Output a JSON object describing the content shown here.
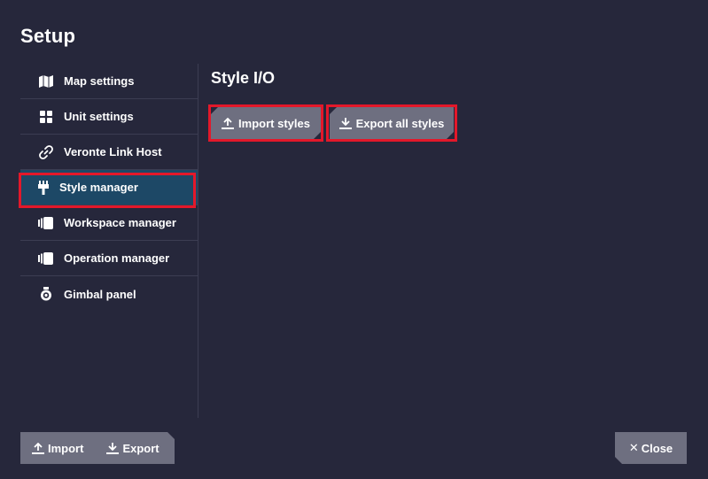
{
  "dialog": {
    "title": "Setup"
  },
  "sidebar": {
    "items": [
      {
        "label": "Map settings",
        "icon": "map-icon"
      },
      {
        "label": "Unit settings",
        "icon": "grid-icon"
      },
      {
        "label": "Veronte Link Host",
        "icon": "link-icon"
      },
      {
        "label": "Style manager",
        "icon": "brush-icon",
        "active": true
      },
      {
        "label": "Workspace manager",
        "icon": "pages-icon"
      },
      {
        "label": "Operation manager",
        "icon": "pages-icon"
      },
      {
        "label": "Gimbal panel",
        "icon": "camera-icon"
      }
    ]
  },
  "main": {
    "section_title": "Style I/O",
    "import_styles_label": "Import styles",
    "export_all_styles_label": "Export all styles"
  },
  "footer": {
    "import_label": "Import",
    "export_label": "Export",
    "close_label": "Close"
  },
  "colors": {
    "background": "#26273b",
    "active_item": "#1d4866",
    "button": "#6e6f80",
    "highlight": "#e3182a"
  }
}
